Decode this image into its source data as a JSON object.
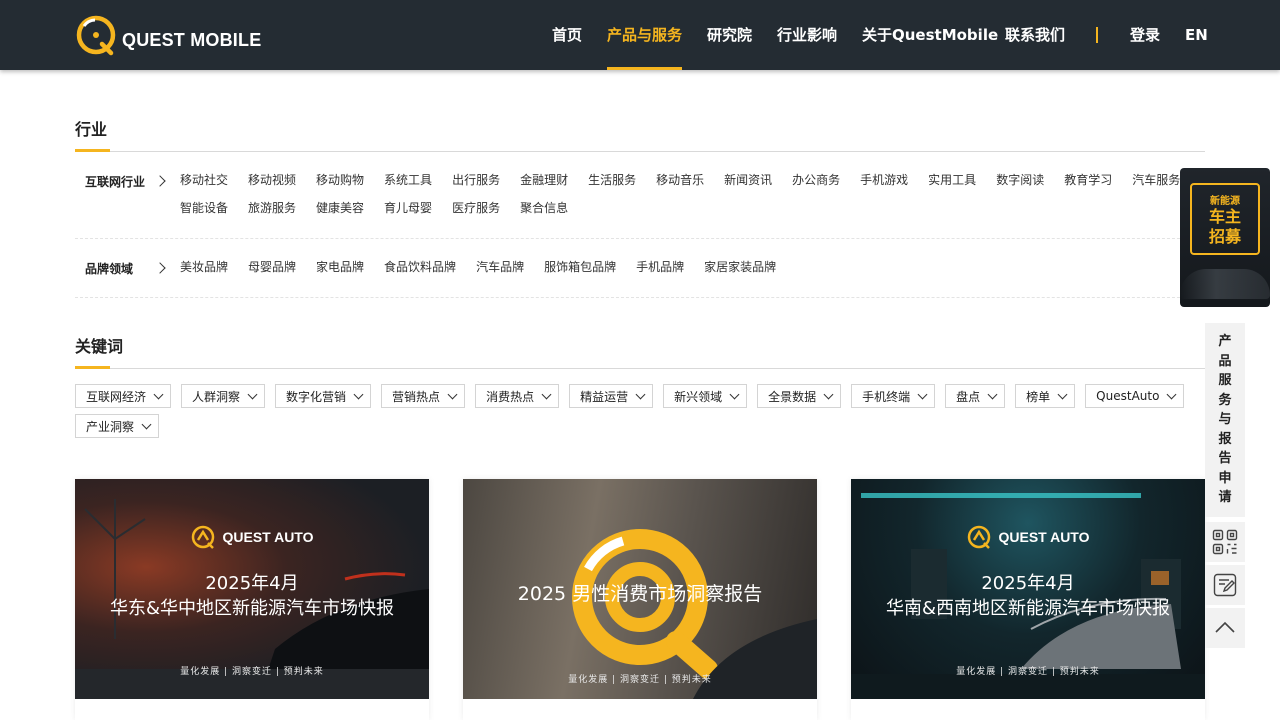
{
  "nav": {
    "logo_text": "QUEST MOBILE",
    "items": [
      {
        "label": "首页",
        "active": false
      },
      {
        "label": "产品与服务",
        "active": true
      },
      {
        "label": "研究院",
        "active": false
      },
      {
        "label": "行业影响",
        "active": false
      },
      {
        "label": "关于QuestMobile",
        "active": false
      },
      {
        "label": "联系我们",
        "active": false
      }
    ],
    "login": "登录",
    "lang": "EN"
  },
  "industry": {
    "title": "行业",
    "rows": [
      {
        "label": "互联网行业",
        "tags": [
          "移动社交",
          "移动视频",
          "移动购物",
          "系统工具",
          "出行服务",
          "金融理财",
          "生活服务",
          "移动音乐",
          "新闻资讯",
          "办公商务",
          "手机游戏",
          "实用工具",
          "数字阅读",
          "教育学习",
          "汽车服务",
          "智能设备",
          "旅游服务",
          "健康美容",
          "育儿母婴",
          "医疗服务",
          "聚合信息"
        ]
      },
      {
        "label": "品牌领域",
        "tags": [
          "美妆品牌",
          "母婴品牌",
          "家电品牌",
          "食品饮料品牌",
          "汽车品牌",
          "服饰箱包品牌",
          "手机品牌",
          "家居家装品牌"
        ]
      }
    ]
  },
  "keywords": {
    "title": "关键词",
    "dropdowns": [
      "互联网经济",
      "人群洞察",
      "数字化营销",
      "营销热点",
      "消费热点",
      "精益运营",
      "新兴领域",
      "全景数据",
      "手机终端",
      "盘点",
      "榜单",
      "QuestAuto",
      "产业洞察"
    ]
  },
  "cards": [
    {
      "brand": "QUEST AUTO",
      "line1": "2025年4月",
      "line2": "华东&华中地区新能源汽车市场快报",
      "slogan": "量化发展 | 洞察变迁 | 预判未来"
    },
    {
      "title": "2025 男性消费市场洞察报告",
      "slogan": "量化发展 | 洞察变迁 | 预判未来"
    },
    {
      "brand": "QUEST AUTO",
      "line1": "2025年4月",
      "line2": "华南&西南地区新能源汽车市场快报",
      "slogan": "量化发展 | 洞察变迁 | 预判未来"
    }
  ],
  "side": {
    "promo_small": "新能源",
    "promo_line1": "车主",
    "promo_line2": "招募",
    "apply_chars": [
      "产",
      "品",
      "服",
      "务",
      "与",
      "报",
      "告",
      "申",
      "请"
    ]
  },
  "colors": {
    "accent": "#f5b51f",
    "nav_bg": "#242c33"
  },
  "icons": [
    "quest-mobile-logo-icon",
    "qr-code-icon",
    "edit-form-icon",
    "back-to-top-icon"
  ]
}
